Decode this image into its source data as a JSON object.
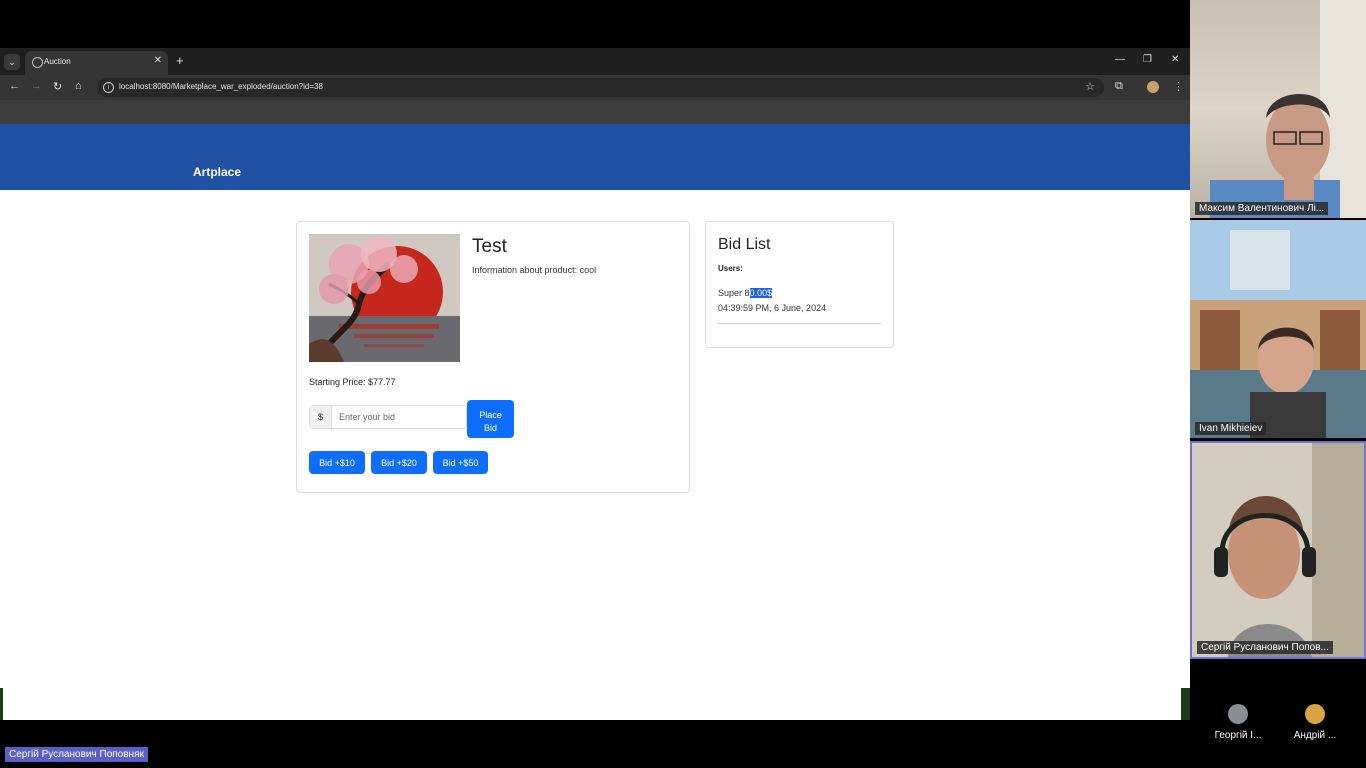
{
  "browser": {
    "tab_title": "Auction",
    "url": "localhost:8080/Marketplace_war_exploded/auction?id=38"
  },
  "page": {
    "brand": "Artplace",
    "product": {
      "title": "Test",
      "description": "Information about product: cool",
      "starting_price_label": "Starting Price: $77.77",
      "currency_symbol": "$",
      "bid_placeholder": "Enter your bid",
      "place_bid_label": "Place\nBid",
      "quick_bids": [
        "Bid +$10",
        "Bid +$20",
        "Bid +$50"
      ]
    },
    "bid_list": {
      "title": "Bid List",
      "users_label": "Users:",
      "entries": [
        {
          "user": "Super",
          "amount_prefix": "8",
          "amount_selected": "0.00$",
          "time": "04:39:59 PM, 6 June, 2024"
        }
      ]
    }
  },
  "meeting": {
    "participants": [
      {
        "name": "Максим Валентинович Лі..."
      },
      {
        "name": "Ivan Mikhieiev"
      },
      {
        "name": "Сергій Русланович Попов..."
      }
    ],
    "others": [
      {
        "name": "Георгій І...",
        "color": "#8a8f96"
      },
      {
        "name": "Андрій ...",
        "color": "#d9a441"
      }
    ],
    "active_speaker": "Сергій Русланович Поповняк"
  },
  "colors": {
    "navbar": "#2050a1",
    "primary_button": "#0d6efd",
    "speaker_label": "#5b5fc7"
  }
}
